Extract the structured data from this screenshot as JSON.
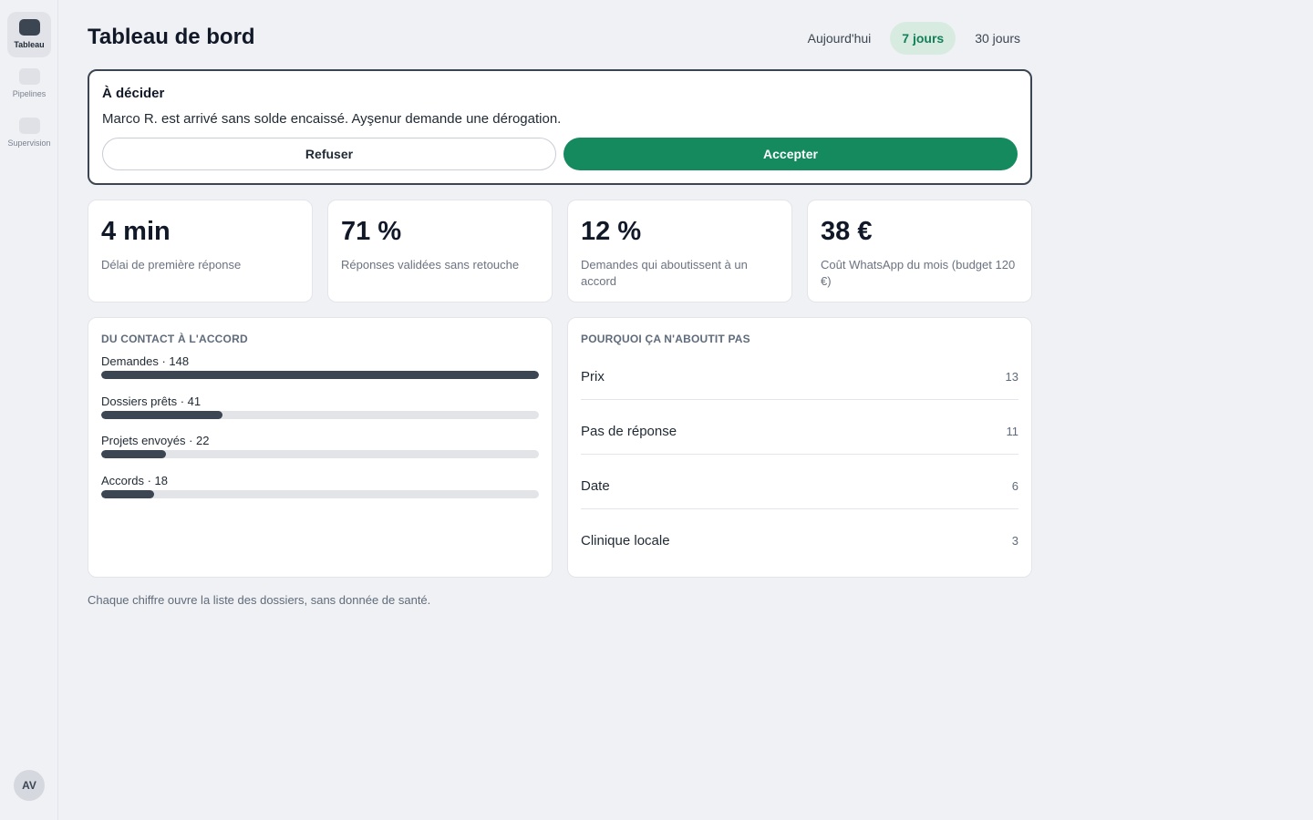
{
  "sidebar": {
    "items": [
      {
        "label": "Tableau"
      },
      {
        "label": "Pipelines"
      },
      {
        "label": "Supervision"
      }
    ],
    "avatar": "AV"
  },
  "header": {
    "title": "Tableau de bord",
    "ranges": [
      "Aujourd'hui",
      "7 jours",
      "30 jours"
    ],
    "selected_range": "7 jours"
  },
  "decision": {
    "title": "À décider",
    "message": "Marco R. est arrivé sans solde encaissé. Ayşenur demande une dérogation.",
    "refuse_label": "Refuser",
    "accept_label": "Accepter"
  },
  "kpis": [
    {
      "value": "4 min",
      "label": "Délai de première réponse"
    },
    {
      "value": "71 %",
      "label": "Réponses validées sans retouche"
    },
    {
      "value": "12 %",
      "label": "Demandes qui aboutissent à un accord"
    },
    {
      "value": "38 €",
      "label": "Coût WhatsApp du mois (budget 120 €)"
    }
  ],
  "funnel": {
    "title": "DU CONTACT À L'ACCORD",
    "stages": [
      {
        "label": "Demandes · 148",
        "value": 148
      },
      {
        "label": "Dossiers prêts · 41",
        "value": 41
      },
      {
        "label": "Projets envoyés · 22",
        "value": 22
      },
      {
        "label": "Accords · 18",
        "value": 18
      }
    ],
    "max": 148
  },
  "reasons": {
    "title": "POURQUOI ÇA N'ABOUTIT PAS",
    "items": [
      {
        "label": "Prix",
        "count": "13"
      },
      {
        "label": "Pas de réponse",
        "count": "11"
      },
      {
        "label": "Date",
        "count": "6"
      },
      {
        "label": "Clinique locale",
        "count": "3"
      }
    ]
  },
  "colors": {
    "accent": "#148a5e",
    "accent_soft": "#d8ebe1",
    "bar": "#3b4652",
    "track": "#e2e4e8"
  },
  "footnote": "Chaque chiffre ouvre la liste des dossiers, sans donnée de santé."
}
